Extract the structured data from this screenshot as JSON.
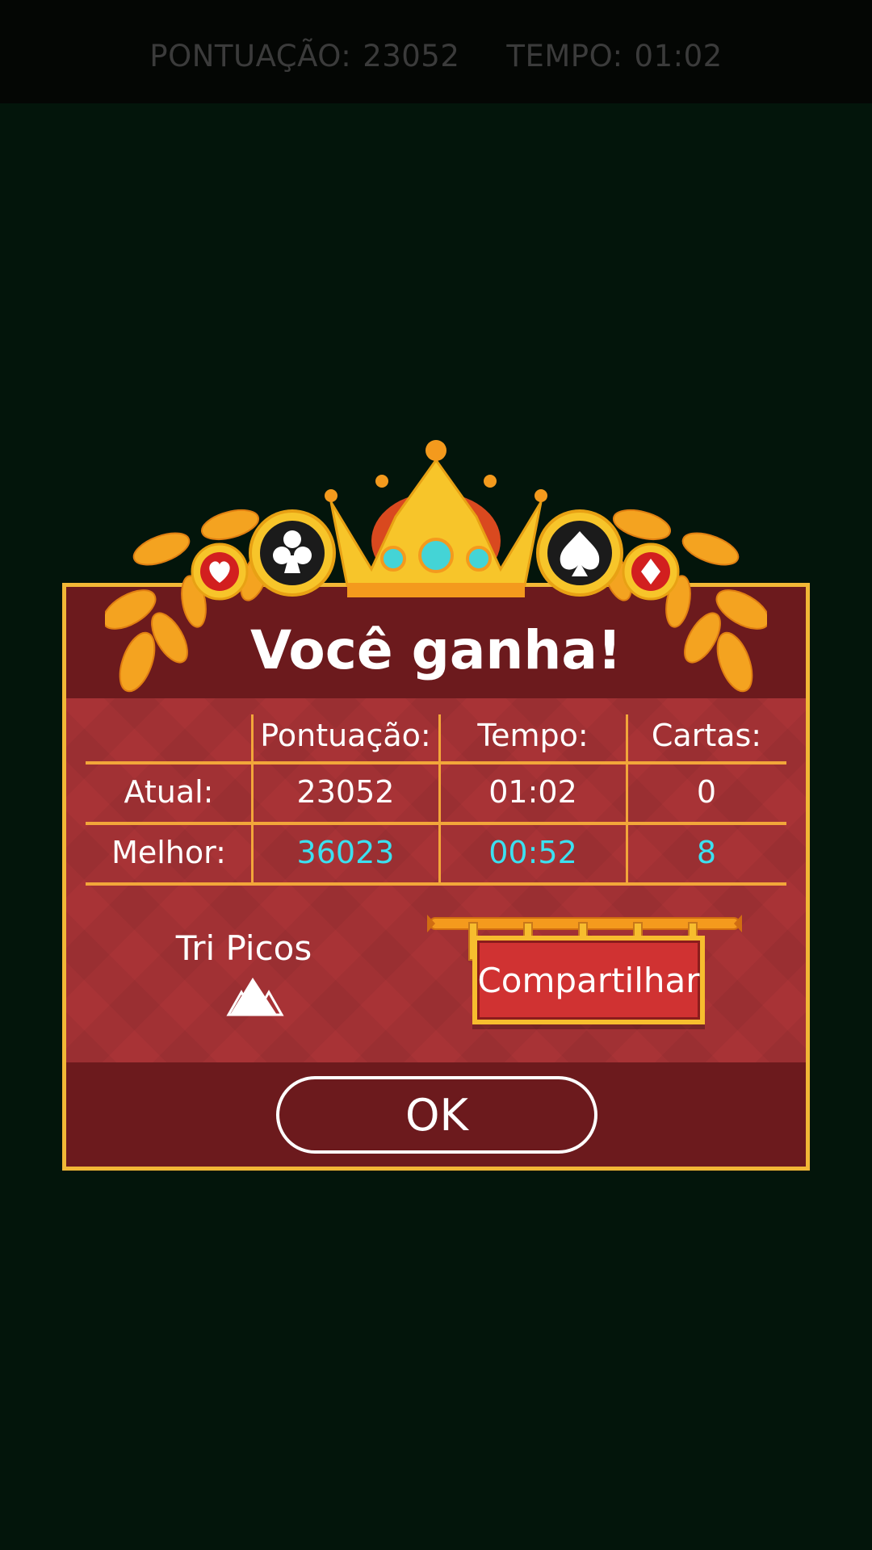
{
  "hud": {
    "score_label": "PONTUAÇÃO:",
    "score_value": "23052",
    "time_label": "TEMPO:",
    "time_value": "01:02"
  },
  "dialog": {
    "title": "Você ganha!",
    "headers": {
      "score": "Pontuação:",
      "time": "Tempo:",
      "cards": "Cartas:"
    },
    "rows": [
      {
        "label": "Atual:",
        "score": "23052",
        "time": "01:02",
        "cards": "0"
      },
      {
        "label": "Melhor:",
        "score": "36023",
        "time": "00:52",
        "cards": "8"
      }
    ],
    "game_name": "Tri Picos",
    "share_label": "Compartilhar",
    "ok_label": "OK"
  },
  "colors": {
    "accent_gold": "#f2b736",
    "best_value": "#3ce0f0",
    "dialog_red": "#a83336",
    "dialog_dark": "#6c1a1d",
    "background": "#03150b"
  },
  "icons": [
    "heart-icon",
    "club-icon",
    "crown-icon",
    "spade-icon",
    "diamond-icon",
    "laurel-icon",
    "tri-peaks-icon"
  ]
}
